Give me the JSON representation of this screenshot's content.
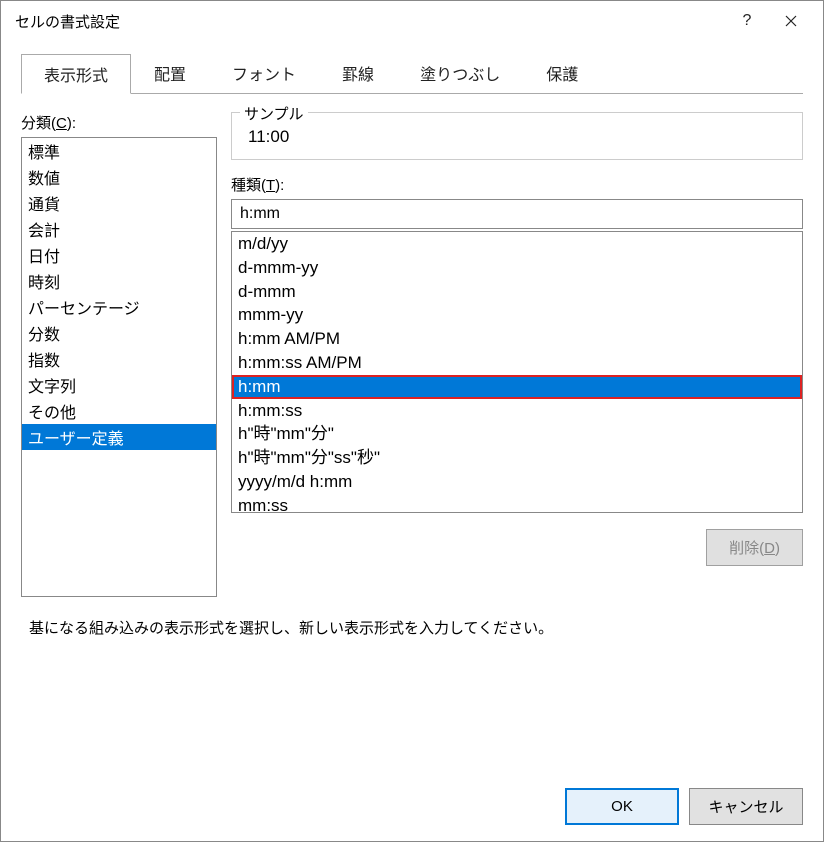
{
  "title": "セルの書式設定",
  "tabs": [
    "表示形式",
    "配置",
    "フォント",
    "罫線",
    "塗りつぶし",
    "保護"
  ],
  "category_label_pre": "分類(",
  "category_label_key": "C",
  "category_label_post": "):",
  "categories": [
    "標準",
    "数値",
    "通貨",
    "会計",
    "日付",
    "時刻",
    "パーセンテージ",
    "分数",
    "指数",
    "文字列",
    "その他",
    "ユーザー定義"
  ],
  "category_selected": 11,
  "sample_label": "サンプル",
  "sample_value": "11:00",
  "type_label_pre": "種類(",
  "type_label_key": "T",
  "type_label_post": "):",
  "type_value": "h:mm",
  "type_items": [
    "m/d/yy",
    "d-mmm-yy",
    "d-mmm",
    "mmm-yy",
    "h:mm AM/PM",
    "h:mm:ss AM/PM",
    "h:mm",
    "h:mm:ss",
    "h\"時\"mm\"分\"",
    "h\"時\"mm\"分\"ss\"秒\"",
    "yyyy/m/d h:mm",
    "mm:ss"
  ],
  "type_selected": 6,
  "delete_label_pre": "削除(",
  "delete_label_key": "D",
  "delete_label_post": ")",
  "hint": "基になる組み込みの表示形式を選択し、新しい表示形式を入力してください。",
  "ok_label": "OK",
  "cancel_label": "キャンセル"
}
